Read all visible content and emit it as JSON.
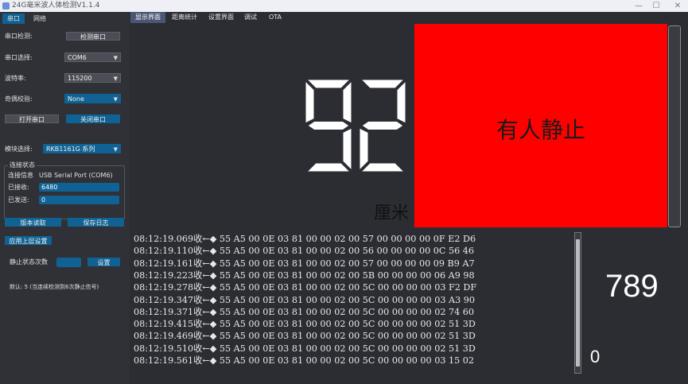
{
  "window": {
    "title": "24G毫米波人体检测V1.1.4",
    "minimize": "—",
    "maximize": "☐",
    "close": "✕"
  },
  "left_tabs": [
    "串口",
    "网络"
  ],
  "serial": {
    "detect_label": "串口检测:",
    "detect_button": "检测串口",
    "port_label": "串口选择:",
    "port_value": "COM6",
    "baud_label": "波特率:",
    "baud_value": "115200",
    "parity_label": "奇偶校验:",
    "parity_value": "None",
    "open_button": "打开串口",
    "close_button": "关闭串口"
  },
  "module": {
    "label": "模块选择:",
    "value": "RKB1161G 系列"
  },
  "connection": {
    "group_title": "连接状态",
    "info_label": "连接信息",
    "info_value": "USB Serial Port (COM6)",
    "received_label": "已接收:",
    "received_value": "6480",
    "sent_label": "已发送:",
    "sent_value": "0"
  },
  "actions": {
    "version_button": "版本读取",
    "save_log_button": "保存日志",
    "apply_button": "应用上层设置"
  },
  "static": {
    "label": "静止状态次数",
    "value": "",
    "set_button": "设置",
    "default_note": "默认: 5 (当连续检测到6次静止信号)"
  },
  "top_tabs": [
    "显示界面",
    "距离统计",
    "设置界面",
    "调试",
    "OTA"
  ],
  "display": {
    "distance": "92",
    "unit": "厘米",
    "status": "有人静止",
    "status_color": "#ff0000"
  },
  "log": [
    "08:12:19.069收←◆ 55 A5 00 0E 03 81 00 00 02 00 57 00 00 00 00 0F E2 D6",
    "08:12:19.110收←◆ 55 A5 00 0E 03 81 00 00 02 00 56 00 00 00 00 0C 56 46",
    "08:12:19.161收←◆ 55 A5 00 0E 03 81 00 00 02 00 57 00 00 00 00 09 B9 A7",
    "08:12:19.223收←◆ 55 A5 00 0E 03 81 00 00 02 00 5B 00 00 00 00 06 A9 98",
    "08:12:19.278收←◆ 55 A5 00 0E 03 81 00 00 02 00 5C 00 00 00 00 03 F2 DF",
    "08:12:19.347收←◆ 55 A5 00 0E 03 81 00 00 02 00 5C 00 00 00 00 03 A3 90",
    "08:12:19.371收←◆ 55 A5 00 0E 03 81 00 00 02 00 5C 00 00 00 00 02 74 60",
    "08:12:19.415收←◆ 55 A5 00 0E 03 81 00 00 02 00 5C 00 00 00 00 02 51 3D",
    "08:12:19.469收←◆ 55 A5 00 0E 03 81 00 00 02 00 5C 00 00 00 00 02 51 3D",
    "08:12:19.510收←◆ 55 A5 00 0E 03 81 00 00 02 00 5C 00 00 00 00 02 51 3D",
    "08:12:19.561收←◆ 55 A5 00 0E 03 81 00 00 02 00 5C 00 00 00 00 03 15 02"
  ],
  "counters": {
    "big": "789",
    "small": "0"
  }
}
